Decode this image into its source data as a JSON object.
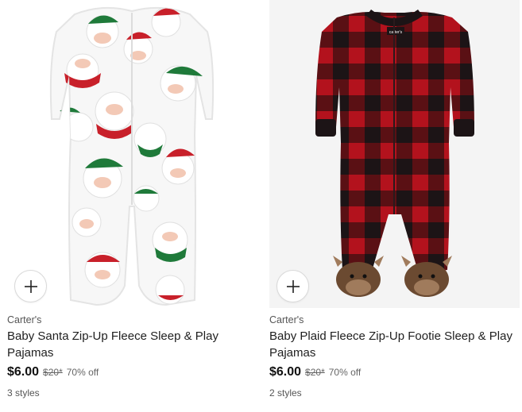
{
  "products": [
    {
      "brand": "Carter's",
      "title": "Baby Santa Zip-Up Fleece Sleep & Play Pajamas",
      "price": "$6.00",
      "original_price": "$20*",
      "discount": "70% off",
      "styles": "3 styles",
      "add_icon": "plus-icon"
    },
    {
      "brand": "Carter's",
      "title": "Baby Plaid Fleece Zip-Up Footie Sleep & Play Pajamas",
      "price": "$6.00",
      "original_price": "$20*",
      "discount": "70% off",
      "styles": "2 styles",
      "add_icon": "plus-icon",
      "label_text": "carter's"
    }
  ],
  "colors": {
    "plaid_red": "#b3121d",
    "plaid_black": "#1c1416",
    "santa_red": "#c8202a",
    "santa_green": "#1f7a3a"
  }
}
